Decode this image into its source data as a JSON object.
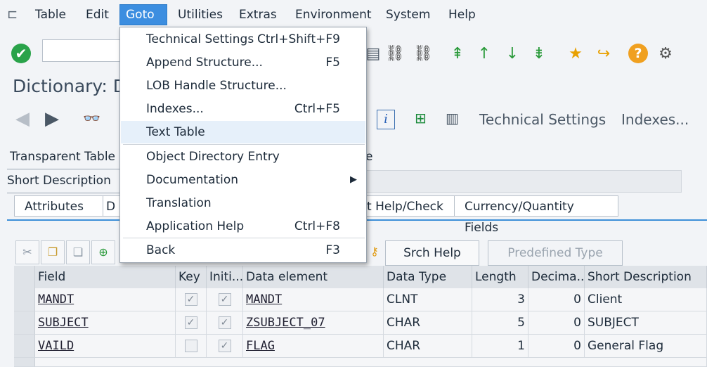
{
  "menubar": {
    "items": [
      "Table",
      "Edit",
      "Goto",
      "Utilities",
      "Extras",
      "Environment",
      "System",
      "Help"
    ]
  },
  "title": "Dictionary: D",
  "app_toolbar": {
    "technical_settings": "Technical Settings",
    "indexes": "Indexes..."
  },
  "fields": {
    "table_type_label": "Transparent Table",
    "table_type_suffix": "e",
    "short_description_label": "Short Description"
  },
  "tabs": [
    "Attributes",
    "D",
    "t Help/Check",
    "Currency/Quantity Fields"
  ],
  "table_toolbar": {
    "srch_help": "Srch Help",
    "predefined_type": "Predefined Type"
  },
  "grid": {
    "headers": [
      "Field",
      "Key",
      "Initi...",
      "Data element",
      "Data Type",
      "Length",
      "Decima...",
      "Short Description"
    ],
    "rows": [
      {
        "field": "MANDT",
        "key": true,
        "initial": true,
        "data_element": "MANDT",
        "data_type": "CLNT",
        "length": "3",
        "decimals": "0",
        "short_description": "Client"
      },
      {
        "field": "SUBJECT",
        "key": true,
        "initial": true,
        "data_element": "ZSUBJECT_07",
        "data_type": "CHAR",
        "length": "5",
        "decimals": "0",
        "short_description": "SUBJECT"
      },
      {
        "field": "VAILD",
        "key": false,
        "initial": true,
        "data_element": "FLAG",
        "data_type": "CHAR",
        "length": "1",
        "decimals": "0",
        "short_description": "General Flag"
      }
    ]
  },
  "goto_menu": {
    "items": [
      {
        "label": "Technical Settings",
        "shortcut": "Ctrl+Shift+F9"
      },
      {
        "label": "Append Structure...",
        "shortcut": "F5"
      },
      {
        "label": "LOB Handle Structure...",
        "shortcut": ""
      },
      {
        "label": "Indexes...",
        "shortcut": "Ctrl+F5"
      },
      {
        "label": "Text Table",
        "shortcut": ""
      },
      {
        "label": "Object Directory Entry",
        "shortcut": ""
      },
      {
        "label": "Documentation",
        "shortcut": "▶"
      },
      {
        "label": "Translation",
        "shortcut": ""
      },
      {
        "label": "Application Help",
        "shortcut": "Ctrl+F8"
      },
      {
        "label": "Back",
        "shortcut": "F3"
      }
    ]
  },
  "colors": {
    "menu_active": "#3c8ee0",
    "highlight": "#e6f0fa",
    "ok_green": "#2aa34a",
    "help_orange": "#f0a020"
  }
}
